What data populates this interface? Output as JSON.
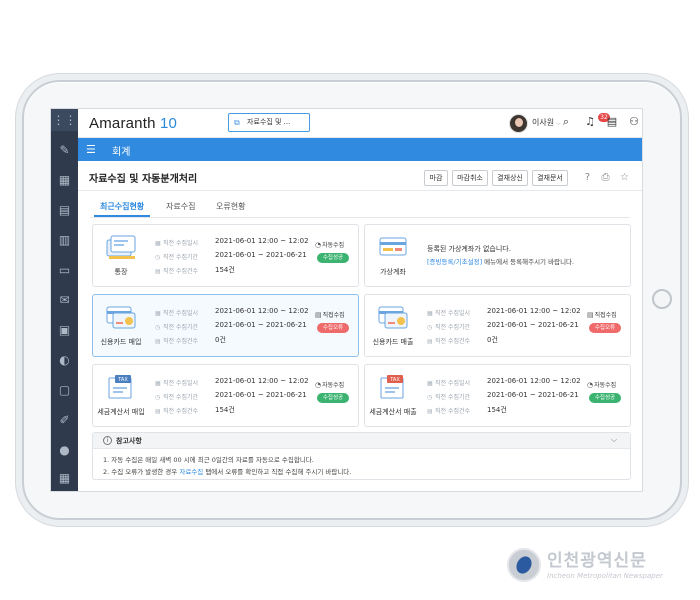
{
  "app": {
    "logo_text": "Amaranth",
    "logo_num": "10",
    "quick_tab_label": "자료수집 및 ..."
  },
  "user": {
    "name": "이사원",
    "notification_count": "32"
  },
  "menu": {
    "title": "회계"
  },
  "page": {
    "title": "자료수집 및 자동분개처리",
    "buttons": [
      "마감",
      "마감취소",
      "결재상신",
      "결재문서"
    ]
  },
  "tabs": [
    {
      "label": "최근수집현황",
      "active": true
    },
    {
      "label": "자료수집",
      "active": false
    },
    {
      "label": "오류현황",
      "active": false
    }
  ],
  "row_labels": {
    "time": "직전 수집일시",
    "period": "직전 수집기간",
    "count": "직전 수집건수"
  },
  "cards": [
    {
      "label": "통장",
      "time": "2021-06-01   12:00 ~ 12:02",
      "period": "2021-06-01 ~ 2021-06-21",
      "count": "154건",
      "mode": "자동수집",
      "status": "수집성공"
    },
    {
      "label": "가상계좌",
      "message1": "등록된 가상계좌가 없습니다.",
      "message_link": "[증빙등록/기초설정]",
      "message2": " 메뉴에서 등록해주시기 바랍니다."
    },
    {
      "label": "신용카드 매입",
      "time": "2021-06-01   12:00 ~ 12:02",
      "period": "2021-06-01 ~ 2021-06-21",
      "count": "0건",
      "mode": "직접수집",
      "status": "수집오류"
    },
    {
      "label": "신용카드 매출",
      "time": "2021-06-01   12:00 ~ 12:02",
      "period": "2021-06-01 ~ 2021-06-21",
      "count": "0건",
      "mode": "직접수집",
      "status": "수집오류"
    },
    {
      "label": "세금계산서 매입",
      "time": "2021-06-01   12:00 ~ 12:02",
      "period": "2021-06-01 ~ 2021-06-21",
      "count": "154건",
      "mode": "자동수집",
      "status": "수집성공"
    },
    {
      "label": "세금계산서 매출",
      "time": "2021-06-01   12:00 ~ 12:02",
      "period": "2021-06-01 ~ 2021-06-21",
      "count": "154건",
      "mode": "자동수집",
      "status": "수집성공"
    }
  ],
  "notes": {
    "title": "참고사항",
    "line1": "1. 자동 수집은 매일 새벽 00 시에 최근 0일간의 자료를 자동으로 수집합니다.",
    "line2_a": "2. 수집 오류가 발생한 경우 ",
    "line2_link": "자료수집",
    "line2_b": " 탭에서 오류를 확인하고 직접 수집해 주시기 바랍니다."
  },
  "watermark": {
    "title": "인천광역신문",
    "subtitle": "Incheon Metropolitan Newspaper"
  },
  "colors": {
    "accent": "#2f8ae0",
    "rail": "#2f3b4c",
    "success": "#3cb371",
    "error": "#ef6a6a"
  },
  "icons": {
    "rail": [
      "apps-icon",
      "pen-icon",
      "calendar-icon",
      "calendar-clock-icon",
      "clipboard-icon",
      "folder-icon",
      "mail-icon",
      "id-card-icon",
      "toggle-icon",
      "monitor-gear-icon",
      "edit-note-icon",
      "person-icon",
      "calculator-icon"
    ],
    "header": [
      "search-icon",
      "bell-icon",
      "document-icon",
      "org-chart-icon",
      "more-vertical-icon"
    ]
  }
}
